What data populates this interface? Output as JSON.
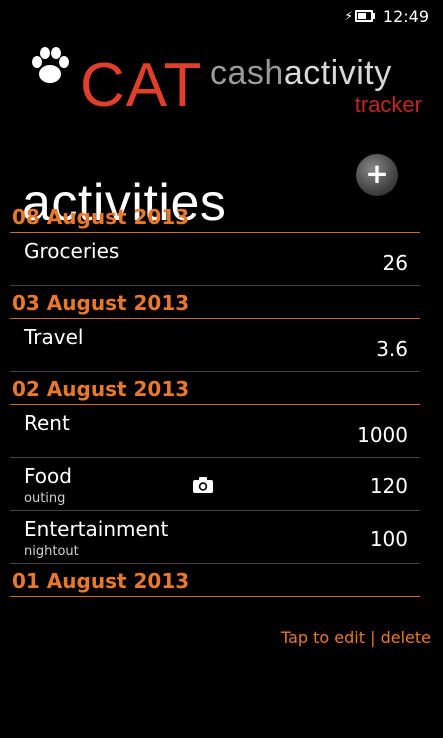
{
  "status": {
    "time": "12:49"
  },
  "logo": {
    "cat": "CAT",
    "cash": "cash",
    "activity": "activity",
    "tracker": "tracker"
  },
  "page": {
    "title": "activities",
    "add_icon": "plus-icon"
  },
  "groups": [
    {
      "date": "08 August 2013",
      "items": [
        {
          "name": "Groceries",
          "note": "",
          "amount": "26"
        }
      ]
    },
    {
      "date": "03 August 2013",
      "items": [
        {
          "name": "Travel",
          "note": "",
          "amount": "3.6"
        }
      ]
    },
    {
      "date": "02 August 2013",
      "items": [
        {
          "name": "Rent",
          "note": "",
          "amount": "1000"
        },
        {
          "name": "Food",
          "note": "outing",
          "amount": "120"
        },
        {
          "name": "Entertainment",
          "note": "nightout",
          "amount": "100"
        }
      ]
    },
    {
      "date": "01 August 2013",
      "items": []
    }
  ],
  "footer": {
    "hint": "Tap to edit | delete"
  },
  "colors": {
    "accent": "#e8782a",
    "logo_red": "#e0402a"
  }
}
